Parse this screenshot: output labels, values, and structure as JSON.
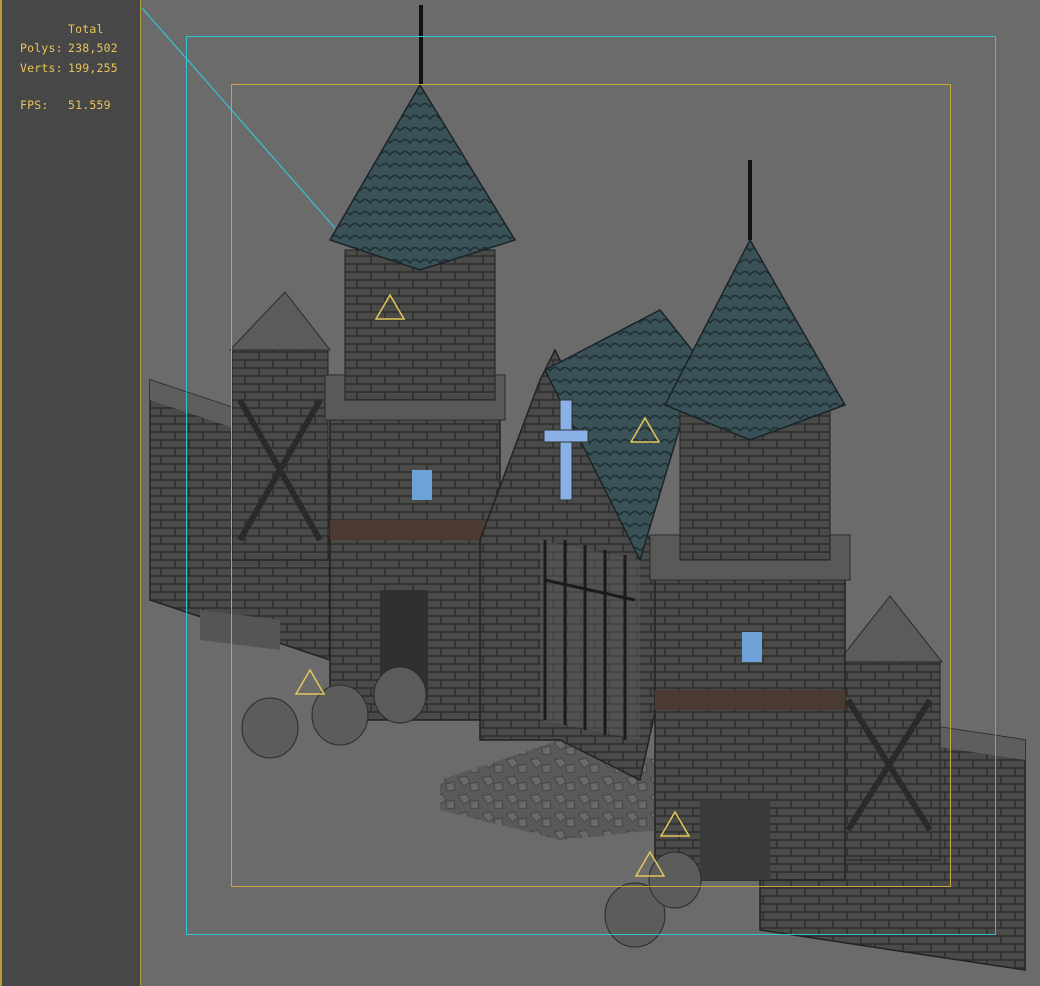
{
  "stats": {
    "title": "Total",
    "polys_label": "Polys:",
    "polys_value": "238,502",
    "verts_label": "Verts:",
    "verts_value": "199,255",
    "fps_label": "FPS:",
    "fps_value": "51.559"
  },
  "viewport": {
    "label": "",
    "accent_outer": "#34c3d2",
    "accent_inner": "#c8a43a",
    "subject": "castle-gate-model"
  }
}
